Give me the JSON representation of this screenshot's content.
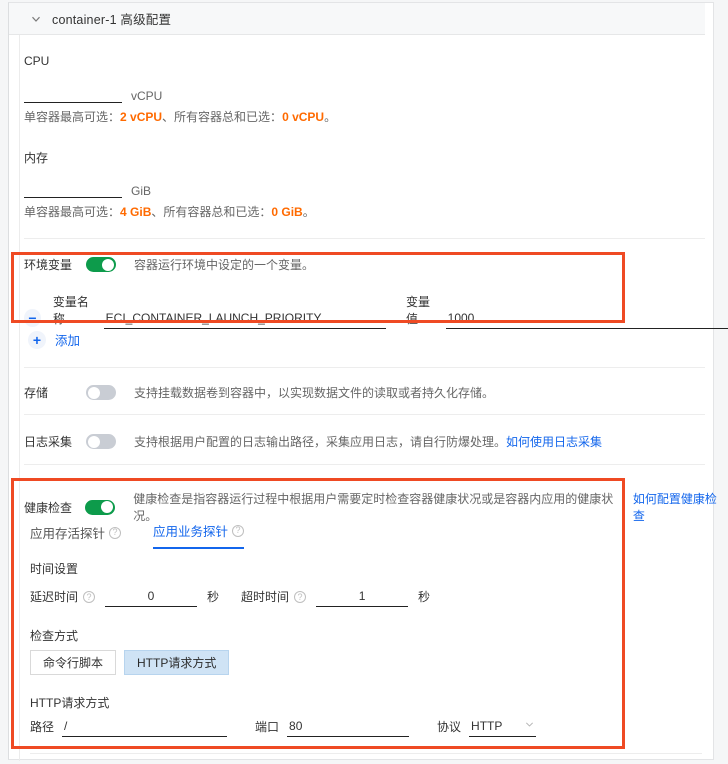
{
  "header": {
    "title": "container-1 高级配置",
    "chevron_icon": "chevron-down-icon"
  },
  "cpu": {
    "label": "CPU",
    "value": "",
    "unit": "vCPU",
    "hint_prefix": "单容器最高可选：",
    "hint_max": "2 vCPU",
    "hint_mid": "、所有容器总和已选：",
    "hint_used": "0 vCPU",
    "hint_suffix": "。"
  },
  "memory": {
    "label": "内存",
    "value": "",
    "unit": "GiB",
    "hint_prefix": "单容器最高可选：",
    "hint_max": "4 GiB",
    "hint_mid": "、所有容器总和已选：",
    "hint_used": "0 GiB",
    "hint_suffix": "。"
  },
  "env": {
    "label": "环境变量",
    "toggle_state": "on",
    "description": "容器运行环境中设定的一个变量。",
    "row": {
      "remove_icon": "minus-icon",
      "name_label": "变量名称",
      "name_value": "ECI_CONTAINER_LAUNCH_PRIORITY",
      "value_label": "变量值",
      "value_value": "1000"
    },
    "add_icon": "plus-icon",
    "add_label": "添加"
  },
  "storage": {
    "label": "存储",
    "toggle_state": "off",
    "description": "支持挂载数据卷到容器中，以实现数据文件的读取或者持久化存储。"
  },
  "logs": {
    "label": "日志采集",
    "toggle_state": "off",
    "description": "支持根据用户配置的日志输出路径，采集应用日志，请自行防爆处理。",
    "link_text": "如何使用日志采集"
  },
  "health": {
    "label": "健康检查",
    "toggle_state": "on",
    "description": "健康检查是指容器运行过程中根据用户需要定时检查容器健康状况或是容器内应用的健康状况。",
    "link_text": "如何配置健康检查",
    "tabs": [
      {
        "label": "应用存活探针",
        "active": false,
        "help_icon": "help-circle-icon"
      },
      {
        "label": "应用业务探针",
        "active": true,
        "help_icon": "help-circle-icon"
      }
    ],
    "time_section_title": "时间设置",
    "delay_label": "延迟时间",
    "delay_value": "0",
    "delay_unit": "秒",
    "timeout_label": "超时时间",
    "timeout_value": "1",
    "timeout_unit": "秒",
    "method_section_title": "检查方式",
    "method_buttons": [
      {
        "label": "命令行脚本",
        "selected": false
      },
      {
        "label": "HTTP请求方式",
        "selected": true
      }
    ],
    "http_section_title": "HTTP请求方式",
    "path_label": "路径",
    "path_value": "/",
    "port_label": "端口",
    "port_value": "80",
    "protocol_label": "协议",
    "protocol_value": "HTTP",
    "protocol_arrow_icon": "chevron-down-icon"
  },
  "colors": {
    "accent_link": "#1366ec",
    "toggle_on": "#0d9b4b",
    "toggle_off": "#c9cdd4",
    "highlight_box": "#ef4a23",
    "warn_text": "#ff6a00"
  }
}
